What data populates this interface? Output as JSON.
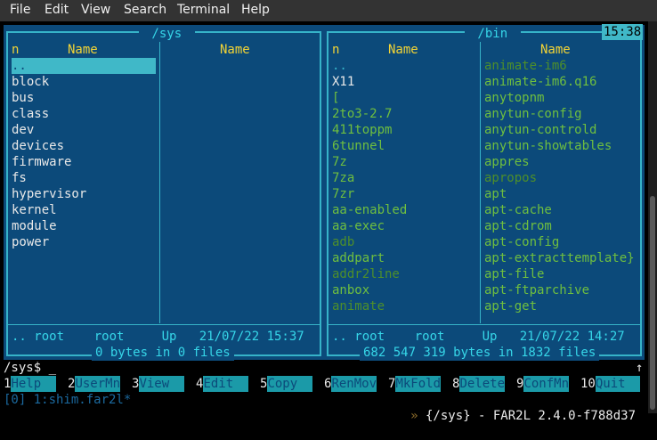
{
  "menu": [
    "File",
    "Edit",
    "View",
    "Search",
    "Terminal",
    "Help"
  ],
  "left_panel": {
    "title": " /sys ",
    "col1_n": "n",
    "col1_header": "Name",
    "col2_header": "Name",
    "files": [
      {
        "name": "..",
        "color": "updir"
      },
      {
        "name": "block",
        "color": "white"
      },
      {
        "name": "bus",
        "color": "white"
      },
      {
        "name": "class",
        "color": "white"
      },
      {
        "name": "dev",
        "color": "white"
      },
      {
        "name": "devices",
        "color": "white"
      },
      {
        "name": "firmware",
        "color": "white"
      },
      {
        "name": "fs",
        "color": "white"
      },
      {
        "name": "hypervisor",
        "color": "white"
      },
      {
        "name": "kernel",
        "color": "white"
      },
      {
        "name": "module",
        "color": "white"
      },
      {
        "name": "power",
        "color": "white"
      }
    ],
    "status": ".. root    root     Up   21/07/22 15:37",
    "summary": "0 bytes in 0 files"
  },
  "right_panel": {
    "title": " /bin ",
    "clock": "15:38",
    "col1_n": "n",
    "col1_header": "Name",
    "col2_header": "Name",
    "files_col1": [
      {
        "name": "..",
        "color": "cyan"
      },
      {
        "name": "X11",
        "color": "white"
      },
      {
        "name": "[",
        "color": "green"
      },
      {
        "name": "2to3-2.7",
        "color": "green"
      },
      {
        "name": "411toppm",
        "color": "green"
      },
      {
        "name": "6tunnel",
        "color": "green"
      },
      {
        "name": "7z",
        "color": "green"
      },
      {
        "name": "7za",
        "color": "green"
      },
      {
        "name": "7zr",
        "color": "green"
      },
      {
        "name": "aa-enabled",
        "color": "green"
      },
      {
        "name": "aa-exec",
        "color": "green"
      },
      {
        "name": "adb",
        "color": "dim"
      },
      {
        "name": "addpart",
        "color": "green"
      },
      {
        "name": "addr2line",
        "color": "dim"
      },
      {
        "name": "anbox",
        "color": "green"
      },
      {
        "name": "animate",
        "color": "dim"
      }
    ],
    "files_col2": [
      {
        "name": "animate-im6",
        "color": "dim"
      },
      {
        "name": "animate-im6.q16",
        "color": "green"
      },
      {
        "name": "anytopnm",
        "color": "green"
      },
      {
        "name": "anytun-config",
        "color": "green"
      },
      {
        "name": "anytun-controld",
        "color": "green"
      },
      {
        "name": "anytun-showtables",
        "color": "green"
      },
      {
        "name": "appres",
        "color": "green"
      },
      {
        "name": "apropos",
        "color": "dim"
      },
      {
        "name": "apt",
        "color": "green"
      },
      {
        "name": "apt-cache",
        "color": "green"
      },
      {
        "name": "apt-cdrom",
        "color": "green"
      },
      {
        "name": "apt-config",
        "color": "green"
      },
      {
        "name": "apt-extracttemplate}",
        "color": "green"
      },
      {
        "name": "apt-file",
        "color": "green"
      },
      {
        "name": "apt-ftparchive",
        "color": "green"
      },
      {
        "name": "apt-get",
        "color": "green"
      }
    ],
    "status": ".. root    root     Up   21/07/22 14:27",
    "summary": "682 547 319 bytes in 1832 files"
  },
  "command_line": "/sys$ _",
  "scroll_arrow": "↑",
  "keybar": [
    {
      "num": "1",
      "label": "Help  "
    },
    {
      "num": "2",
      "label": "UserMn"
    },
    {
      "num": "3",
      "label": "View  "
    },
    {
      "num": "4",
      "label": "Edit  "
    },
    {
      "num": "5",
      "label": "Copy  "
    },
    {
      "num": "6",
      "label": "RenMov"
    },
    {
      "num": "7",
      "label": "MkFold"
    },
    {
      "num": "8",
      "label": "Delete"
    },
    {
      "num": "9",
      "label": "ConfMn"
    },
    {
      "num": "10",
      "label": "Quit  "
    }
  ],
  "tmux_left": "[0] 1:shim.far2l*",
  "tmux_right_arrow": "»",
  "tmux_right": " {/sys} - FAR2L 2.4.0-f788d37"
}
